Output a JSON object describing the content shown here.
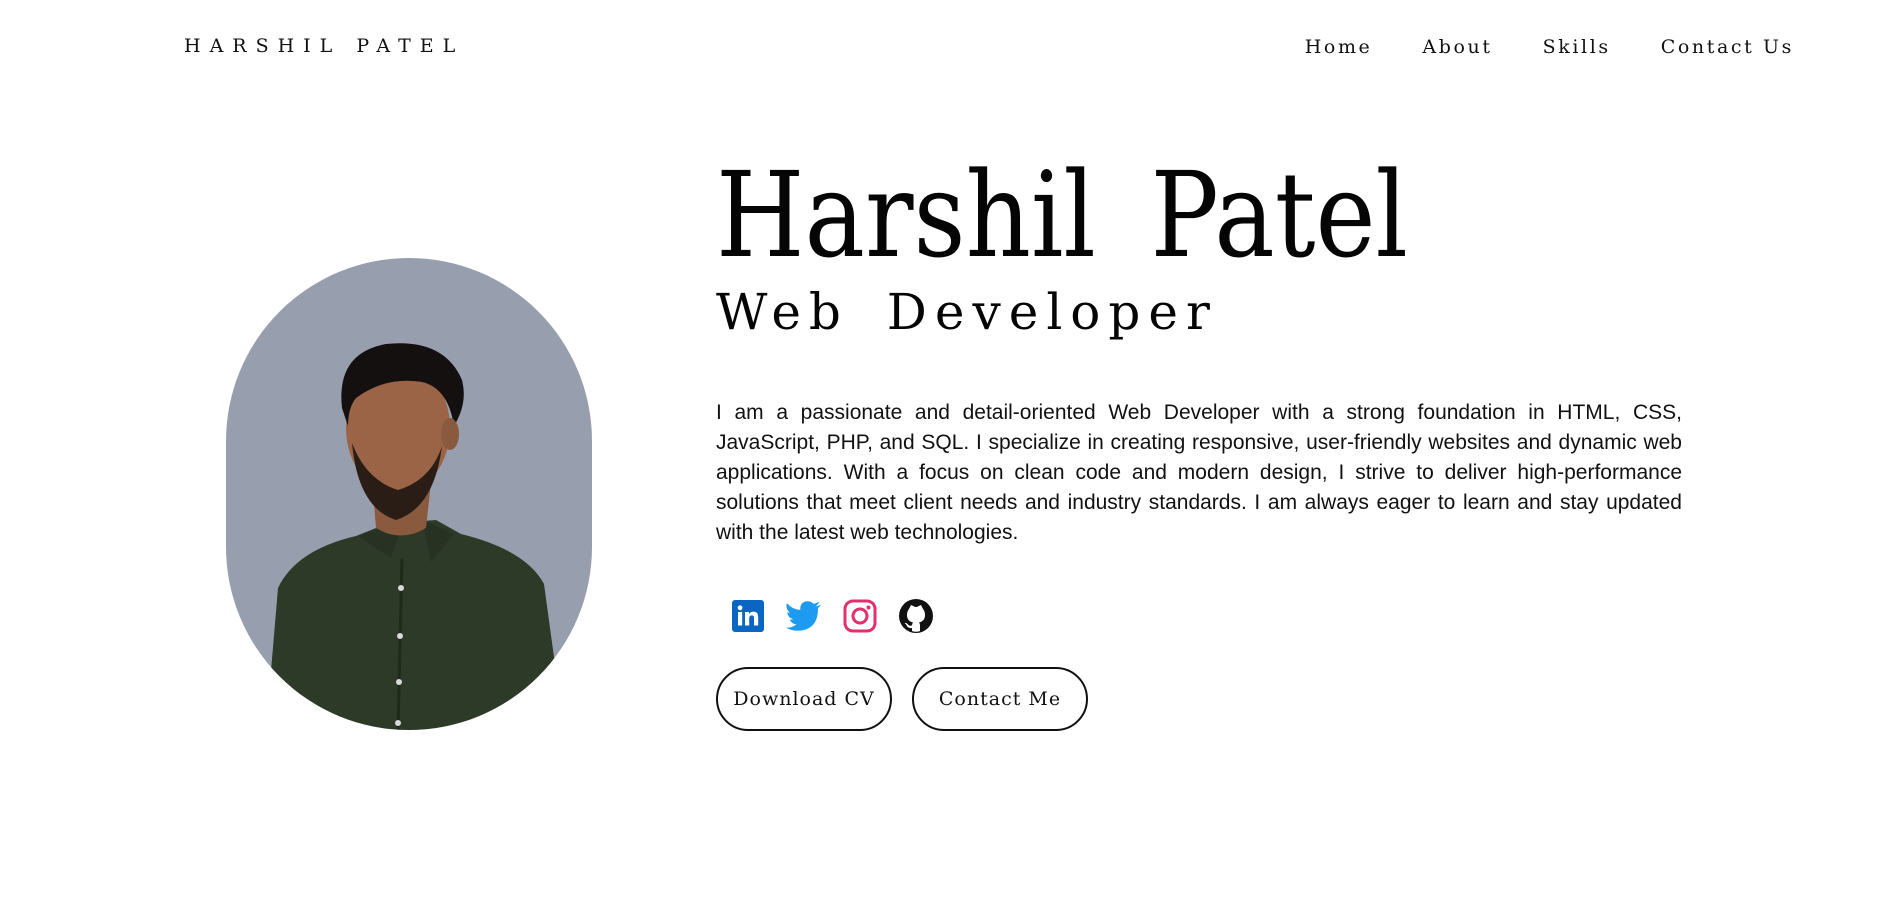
{
  "header": {
    "brand": "HARSHIL PATEL",
    "nav": [
      {
        "label": "Home"
      },
      {
        "label": "About"
      },
      {
        "label": "Skills"
      },
      {
        "label": "Contact Us"
      }
    ]
  },
  "hero": {
    "name": "Harshil Patel",
    "role": "Web Developer",
    "bio": "I am a passionate and detail-oriented Web Developer with a strong foundation in HTML, CSS, JavaScript, PHP, and SQL. I specialize in creating responsive, user-friendly websites and dynamic web applications. With a focus on clean code and modern design, I strive to deliver high-performance solutions that meet client needs and industry standards. I am always eager to learn and stay updated with the latest web technologies.",
    "socials": [
      {
        "icon": "linkedin-icon",
        "color": "#0a66c2"
      },
      {
        "icon": "twitter-icon",
        "color": "#1d9bf0"
      },
      {
        "icon": "instagram-icon",
        "color": "#e1306c"
      },
      {
        "icon": "github-icon",
        "color": "#111111"
      }
    ],
    "buttons": {
      "download_cv": "Download CV",
      "contact_me": "Contact Me"
    }
  },
  "colors": {
    "portrait_bg": "#979fae",
    "shirt": "#2e3a28",
    "text": "#0a0a0a"
  }
}
